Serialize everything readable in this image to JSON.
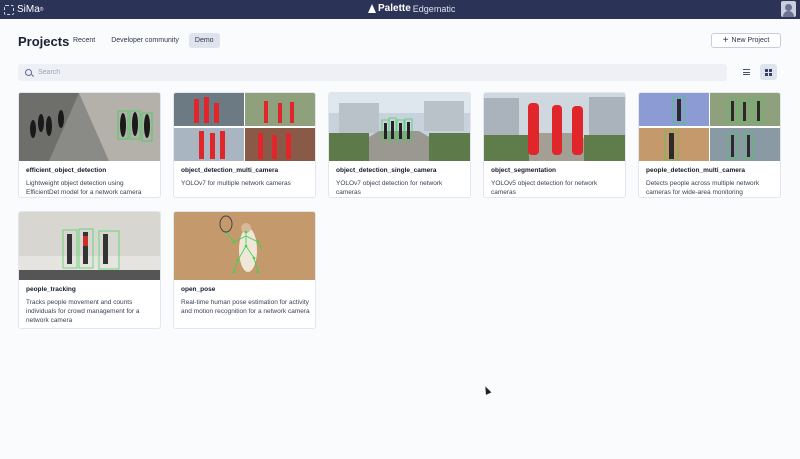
{
  "app": {
    "logo": "SiMa",
    "logo_mark": "®",
    "brand": "Palette",
    "brand_sub": "Edgematic"
  },
  "header": {
    "title": "Projects",
    "tabs": [
      {
        "label": "Recent",
        "active": false
      },
      {
        "label": "Developer community",
        "active": false
      },
      {
        "label": "Demo",
        "active": true
      }
    ],
    "new_project_label": "New Project"
  },
  "search": {
    "placeholder": "Search",
    "value": ""
  },
  "view_toggle": {
    "selected": "grid"
  },
  "projects": [
    {
      "title": "efficient_object_detection",
      "description": "Lightweight object detection using EfficientDet model for a network camera",
      "thumbnail": "people-shadows-street-with-detection-boxes"
    },
    {
      "title": "object_detection_multi_camera",
      "description": "YOLOv7 for multiple network cameras",
      "thumbnail": "four-camera-grid-red-segmented-people"
    },
    {
      "title": "object_detection_single_camera",
      "description": "YOLOv7 object detection for network cameras",
      "thumbnail": "campus-walkway-people-detection"
    },
    {
      "title": "object_segmentation",
      "description": "YOLOv5 object detection for network cameras",
      "thumbnail": "red-segmented-people-walkway"
    },
    {
      "title": "people_detection_multi_camera",
      "description": "Detects people across multiple network cameras for wide-area monitoring",
      "thumbnail": "four-camera-grid-people"
    },
    {
      "title": "people_tracking",
      "description": "Tracks people movement and counts individuals for crowd management for a network camera",
      "thumbnail": "people-walking-along-wall"
    },
    {
      "title": "open_pose",
      "description": "Real-time human pose estimation for activity and motion recognition for a network camera",
      "thumbnail": "tennis-player-pose-keypoints"
    }
  ],
  "colors": {
    "topbar": "#2b3357",
    "accent": "#2b3357",
    "detection_box": "#39d353",
    "segmentation": "#e0262b"
  }
}
